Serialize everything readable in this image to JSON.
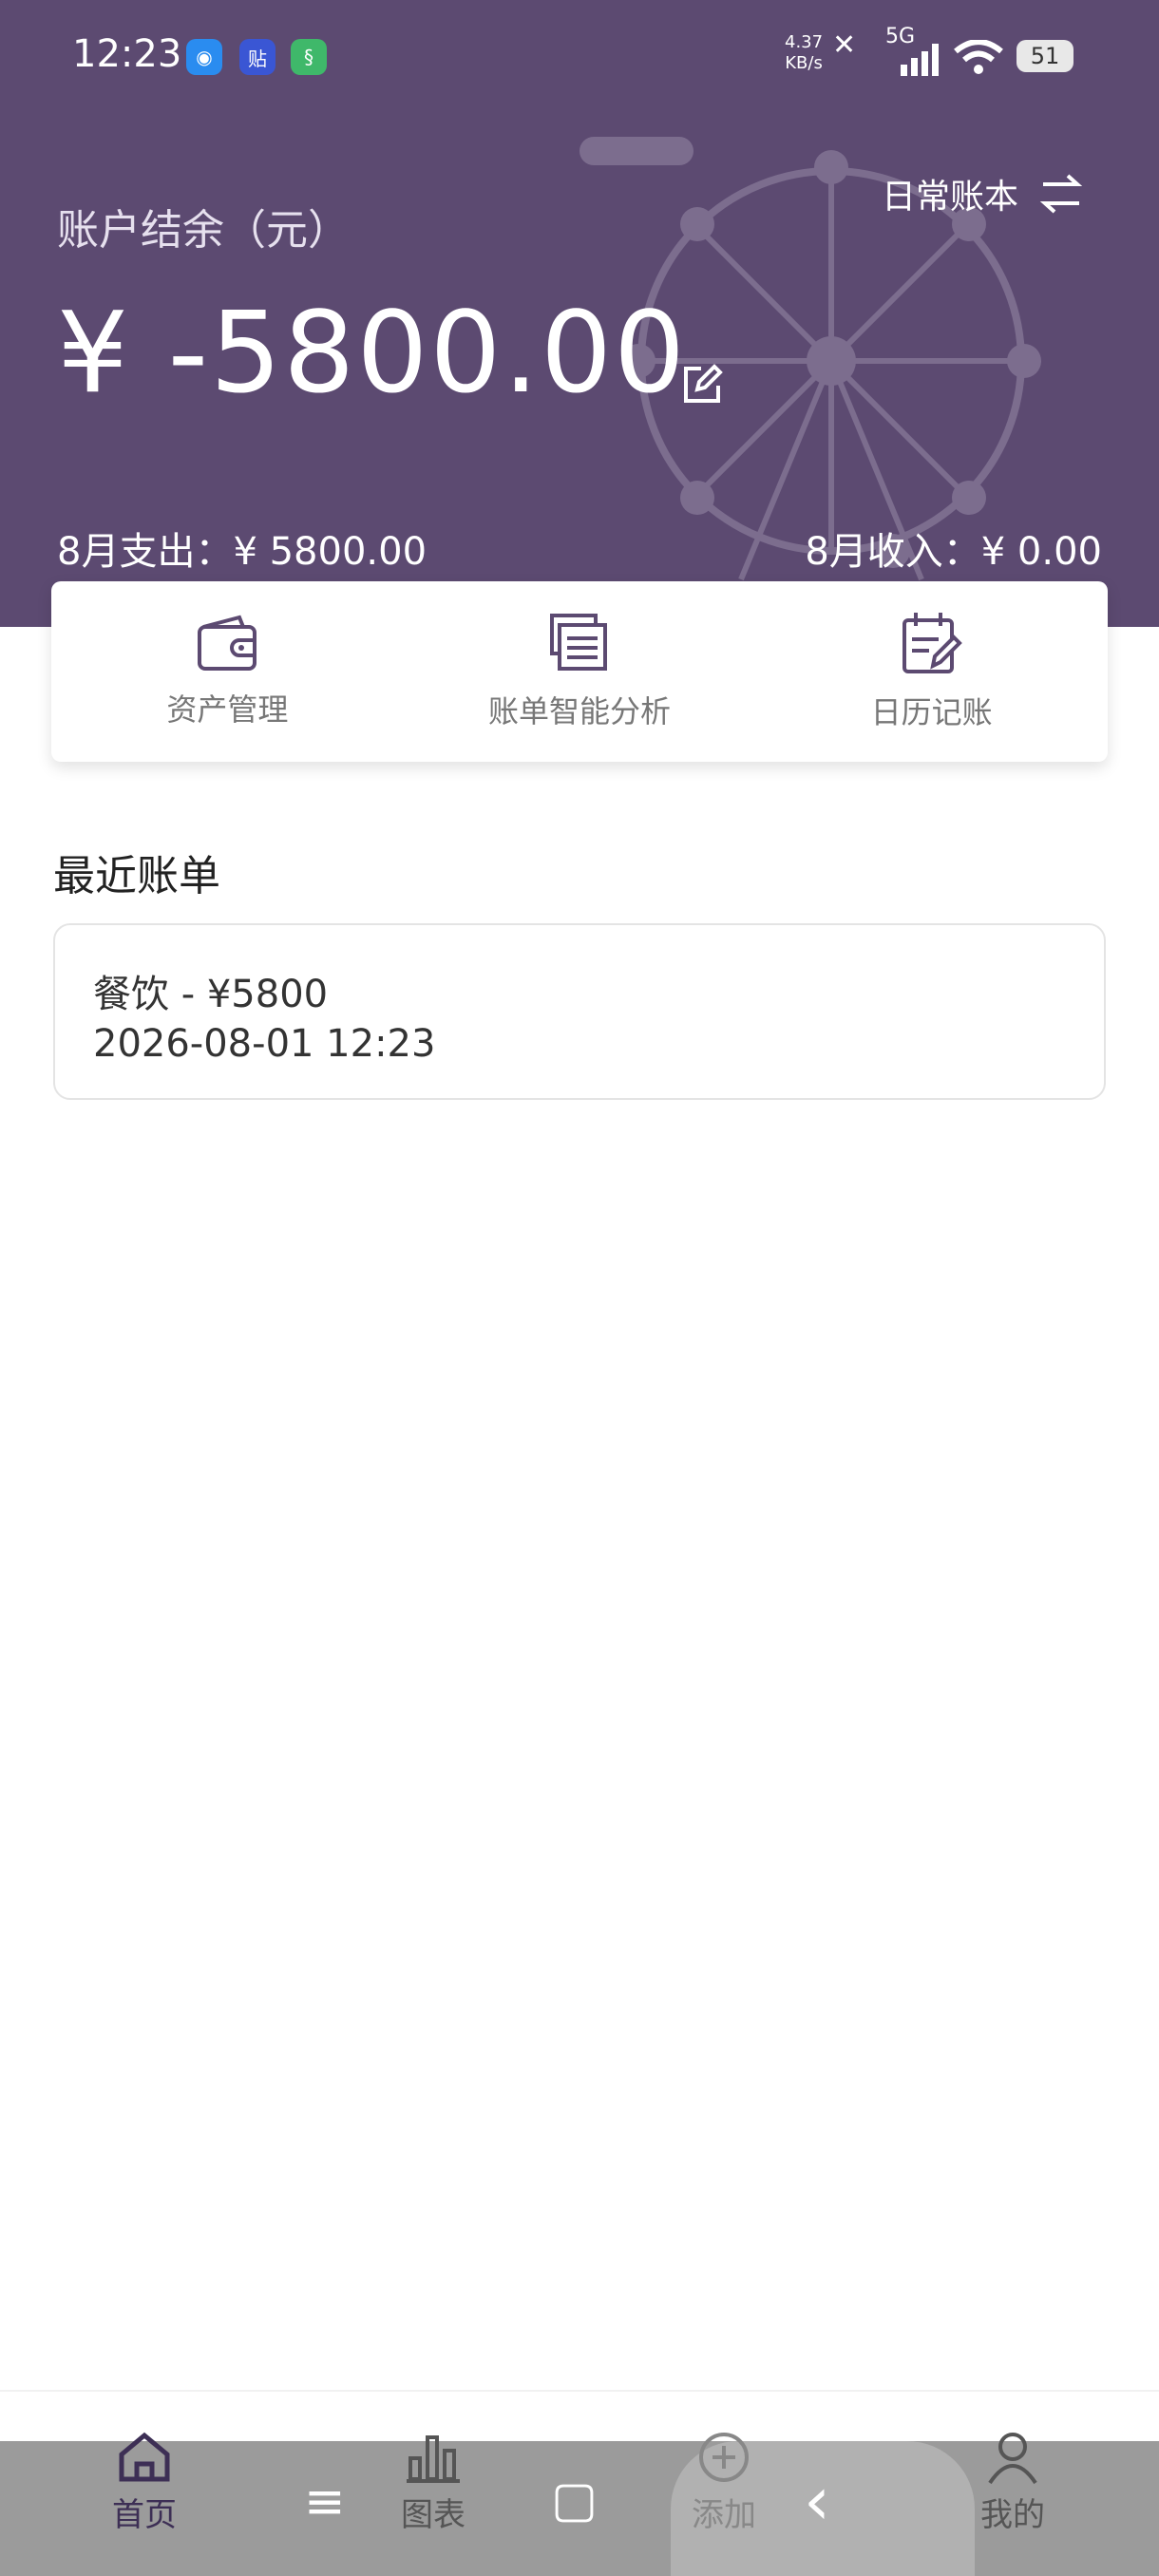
{
  "status_bar": {
    "time": "12:23",
    "net_speed_value": "4.37",
    "net_speed_unit": "KB/s",
    "network": "5G",
    "battery": "51"
  },
  "header": {
    "ledger_name": "日常账本",
    "balance_label": "账户结余（元）",
    "balance": "¥ -5800.00",
    "month_expense": "8月支出：¥ 5800.00",
    "month_income": "8月收入：¥ 0.00"
  },
  "quick_actions": [
    {
      "label": "资产管理",
      "icon": "wallet-icon"
    },
    {
      "label": "账单智能分析",
      "icon": "documents-icon"
    },
    {
      "label": "日历记账",
      "icon": "calendar-edit-icon"
    }
  ],
  "recent": {
    "title": "最近账单",
    "items": [
      {
        "summary": "餐饮  - ¥5800",
        "datetime": "2026-08-01 12:23"
      }
    ]
  },
  "tabbar": {
    "items": [
      {
        "label": "首页",
        "icon": "home-icon",
        "active": true
      },
      {
        "label": "图表",
        "icon": "bar-chart-icon",
        "active": false
      },
      {
        "label": "添加",
        "icon": "plus-circle-icon",
        "active": false
      },
      {
        "label": "我的",
        "icon": "person-icon",
        "active": false
      }
    ]
  },
  "system_nav": {
    "menu": "≡",
    "home": "▢",
    "back": "‹"
  },
  "colors": {
    "header_bg": "#5c4a71",
    "accent": "#5c4a71",
    "text_muted": "#777777"
  }
}
